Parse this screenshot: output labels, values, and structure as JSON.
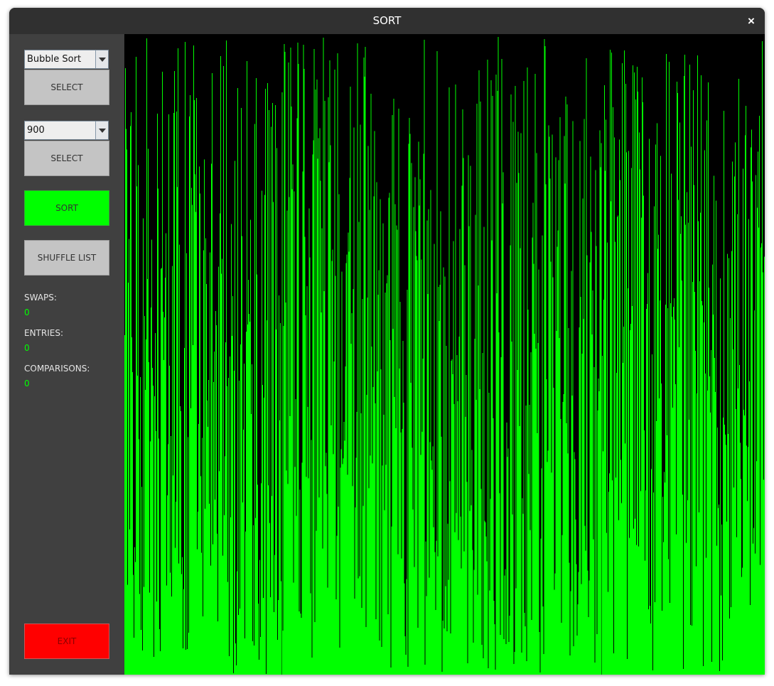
{
  "window": {
    "title": "SORT",
    "close_glyph": "×"
  },
  "controls": {
    "algorithm_selected": "Bubble Sort",
    "select_label": "SELECT",
    "size_selected": "900",
    "size_select_label": "SELECT",
    "sort_label": "SORT",
    "shuffle_label": "SHUFFLE LIST",
    "exit_label": "EXIT"
  },
  "stats": {
    "swaps_label": "SWAPS:",
    "swaps_value": "0",
    "entries_label": "ENTRIES:",
    "entries_value": "0",
    "comparisons_label": "COMPARISONS:",
    "comparisons_value": "0"
  },
  "colors": {
    "bar": "#00ff00",
    "canvas_background": "#000000",
    "sort_button": "#00ff00",
    "exit_button": "#ff0000"
  },
  "visualization": {
    "bar_count": 900,
    "order": "shuffled"
  }
}
